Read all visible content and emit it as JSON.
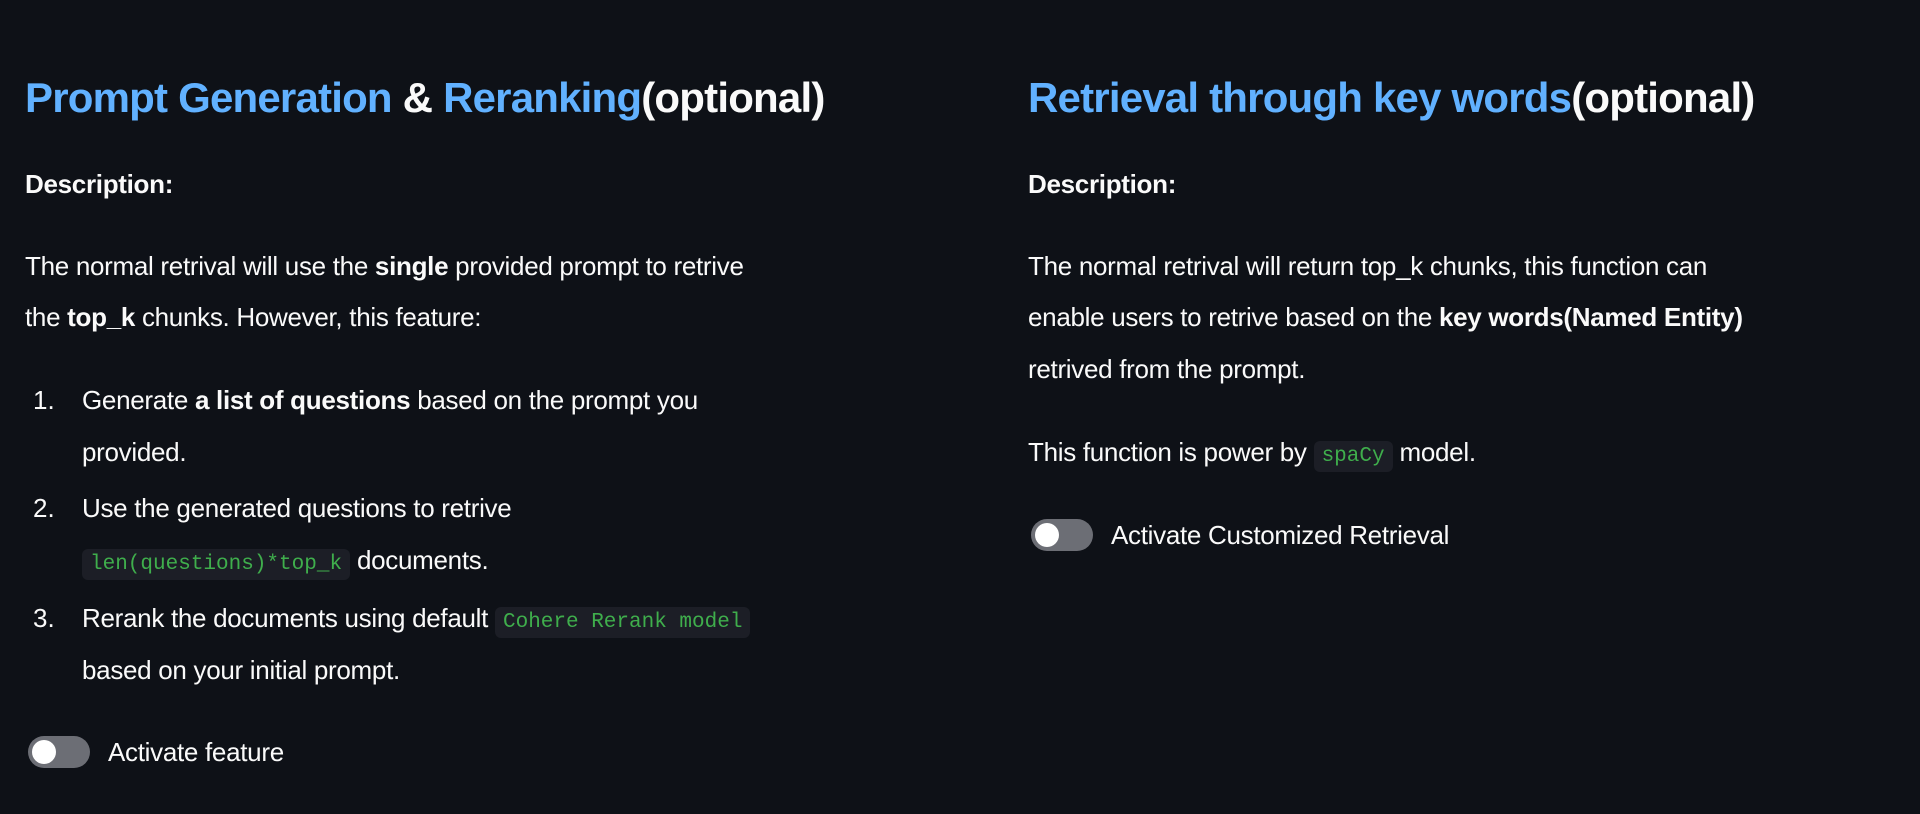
{
  "left": {
    "title": {
      "part1": "Prompt Generation",
      "amp": " & ",
      "part2": "Reranking",
      "suffix": "(optional)"
    },
    "description_label": "Description:",
    "para": {
      "l1a": "The normal retrival will use the ",
      "l1b": "single",
      "l1c": " provided prompt to retrive",
      "l2a": "the ",
      "l2b": "top_k",
      "l2c": " chunks. However, this feature:"
    },
    "list": [
      {
        "num": "1.",
        "a": "Generate ",
        "b": "a list of questions",
        "c": " based on the prompt you",
        "d": "provided."
      },
      {
        "num": "2.",
        "a": "Use the generated questions to retrive",
        "code": "len(questions)*top_k",
        "c": " documents."
      },
      {
        "num": "3.",
        "a": "Rerank the documents using default ",
        "code": "Cohere Rerank model",
        "d": "based on your initial prompt."
      }
    ],
    "toggle_label": "Activate feature",
    "toggle_on": false
  },
  "right": {
    "title": {
      "part1": "Retrieval through key words",
      "suffix": "(optional)"
    },
    "description_label": "Description:",
    "para": {
      "l1": "The normal retrival will return top_k chunks, this function can",
      "l2a": "enable users to retrive based on the ",
      "l2b": "key words(Named Entity)",
      "l3": "retrived from the prompt."
    },
    "powered": {
      "a": "This function is power by ",
      "code": "spaCy",
      "c": " model."
    },
    "toggle_label": "Activate Customized Retrieval",
    "toggle_on": false
  },
  "colors": {
    "background": "#0e1117",
    "accent": "#61b1ff",
    "code": "#3fae4c"
  }
}
